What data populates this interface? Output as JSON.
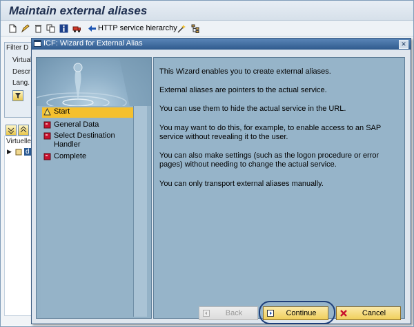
{
  "app": {
    "title": "Maintain external aliases"
  },
  "toolbar": {
    "http_hierarchy_label": "HTTP service hierarchy",
    "icons": [
      "create-icon",
      "edit-icon",
      "delete-icon",
      "copy-icon",
      "info-icon",
      "transport-icon",
      "back-arrow-icon",
      "wand-icon",
      "hierarchy-icon"
    ]
  },
  "background": {
    "filter_label": "Filter D",
    "virtual_label": "Virtual",
    "descr_label": "Descr",
    "lang_label": "Lang.",
    "tree_header": "Virtuelle",
    "tree_node_label": "d"
  },
  "dialog": {
    "title": "ICF: Wizard for External Alias",
    "steps": [
      {
        "label": "Start",
        "icon": "warning-triangle-icon",
        "active": true
      },
      {
        "label": "General Data",
        "icon": "red-square-icon",
        "active": false
      },
      {
        "label": "Select Destination Handler",
        "icon": "red-square-icon",
        "active": false
      },
      {
        "label": "Complete",
        "icon": "red-square-icon",
        "active": false
      }
    ],
    "paragraphs": [
      "This Wizard enables you to create external aliases.",
      "External aliases are pointers to the actual service.",
      "You can use them to hide the actual service in the URL.",
      "You may want to do this, for example, to enable access to an SAP service without revealing it to the user.",
      "You can also make settings (such as the logon procedure or error pages) without needing to change the actual service.",
      "You can only transport external aliases manually."
    ],
    "buttons": {
      "back": "Back",
      "continue": "Continue",
      "cancel": "Cancel"
    }
  },
  "colors": {
    "active_step": "#f5c02e",
    "panel": "#96b4c9",
    "highlight_ring": "#1f3f7a"
  }
}
